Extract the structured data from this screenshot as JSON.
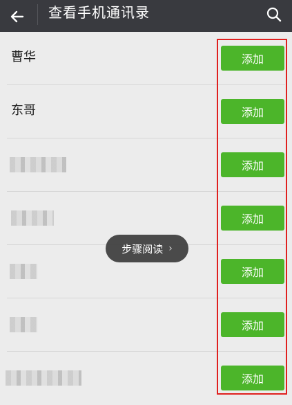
{
  "header": {
    "title": "查看手机通讯录"
  },
  "contacts": [
    {
      "name": "曹华",
      "blurred": false,
      "add_label": "添加"
    },
    {
      "name": "东哥",
      "blurred": false,
      "add_label": "添加"
    },
    {
      "name": "",
      "blurred": true,
      "add_label": "添加"
    },
    {
      "name": "",
      "blurred": true,
      "add_label": "添加"
    },
    {
      "name": "",
      "blurred": true,
      "add_label": "添加"
    },
    {
      "name": "",
      "blurred": true,
      "add_label": "添加"
    },
    {
      "name": "",
      "blurred": true,
      "add_label": "添加"
    }
  ],
  "toast": {
    "label": "步骤阅读",
    "chevron": "›"
  },
  "colors": {
    "header_bg": "#393a3f",
    "add_button": "#4cb52a",
    "highlight": "#e0201e"
  },
  "icons": {
    "back": "arrow-left-icon",
    "search": "search-icon"
  }
}
